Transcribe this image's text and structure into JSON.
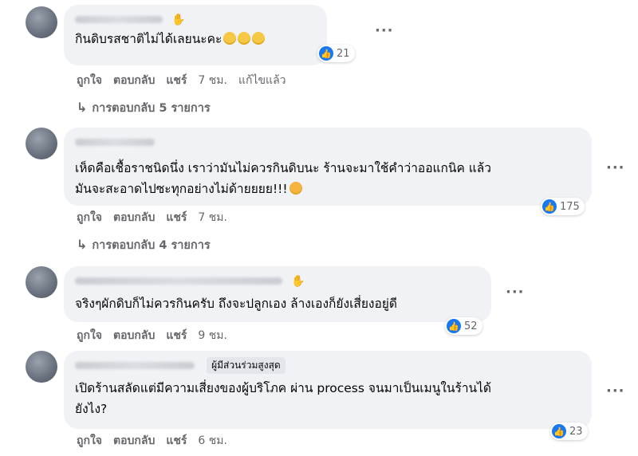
{
  "comments": [
    {
      "text": "กินดิบรสชาติไม่ได้เลยนะคะ",
      "reactions": "21",
      "actions": {
        "like": "ถูกใจ",
        "reply": "ตอบกลับ",
        "share": "แชร์",
        "time": "7 ชม.",
        "edited": "แก้ไขแล้ว"
      },
      "replies": "การตอบกลับ 5 รายการ"
    },
    {
      "text_line1": "เห็ดคือเชื้อราชนิดนึ่ง เราว่ามันไม่ควรกินดิบนะ ร้านจะมาใช้คำว่าออแกนิค แล้ว",
      "text_line2": "มันจะสะอาดไปซะทุกอย่างไม่ด้ายยยย!!!",
      "reactions": "175",
      "actions": {
        "like": "ถูกใจ",
        "reply": "ตอบกลับ",
        "share": "แชร์",
        "time": "7 ชม."
      },
      "replies": "การตอบกลับ 4 รายการ"
    },
    {
      "text": "จริงๆผักดิบก็ไม่ควรกินครับ ถึงจะปลูกเอง ล้างเองก็ยังเสี่ยงอยู่ดี",
      "reactions": "52",
      "actions": {
        "like": "ถูกใจ",
        "reply": "ตอบกลับ",
        "share": "แชร์",
        "time": "9 ชม."
      }
    },
    {
      "badge": "ผู้มีส่วนร่วมสูงสุด",
      "text_line1": "เปิดร้านสลัดแต่มีความเสี่ยงของผู้บริโภค ผ่าน process จนมาเป็นเมนูในร้านได้",
      "text_line2": "ยังไง?",
      "reactions": "23",
      "actions": {
        "like": "ถูกใจ",
        "reply": "ตอบกลับ",
        "share": "แชร์",
        "time": "6 ชม."
      }
    }
  ],
  "icons": {
    "more": "more-horizontal-icon",
    "like": "like-icon",
    "reply_arrow": "reply-arrow-icon",
    "wave": "wave-hand-icon"
  },
  "colors": {
    "like_blue": "#1877f2",
    "bubble": "#f0f2f5",
    "muted": "#65676b"
  }
}
